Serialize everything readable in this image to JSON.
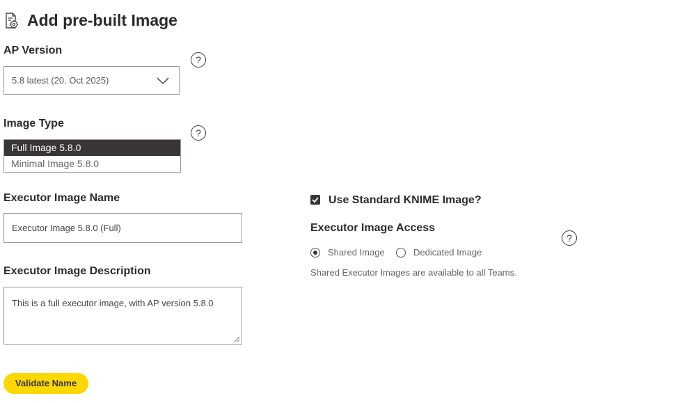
{
  "page": {
    "title": "Add pre-built Image",
    "title_icon": "document-gear-icon"
  },
  "ap_version": {
    "label": "AP Version",
    "selected": "5.8 latest (20. Oct 2025)",
    "help": "?"
  },
  "image_type": {
    "label": "Image Type",
    "help": "?",
    "options": [
      {
        "label": "Full Image 5.8.0",
        "selected": true
      },
      {
        "label": "Minimal Image 5.8.0",
        "selected": false
      }
    ]
  },
  "executor_name": {
    "label": "Executor Image Name",
    "value": "Executor Image 5.8.0 (Full)"
  },
  "executor_description": {
    "label": "Executor Image Description",
    "value": "This is a full executor image, with AP version 5.8.0"
  },
  "standard_image": {
    "label": "Use Standard KNIME Image?",
    "checked": true
  },
  "access": {
    "label": "Executor Image Access",
    "help": "?",
    "options": [
      {
        "label": "Shared Image",
        "selected": true
      },
      {
        "label": "Dedicated Image",
        "selected": false
      }
    ],
    "hint": "Shared Executor Images are available to all Teams."
  },
  "validate_button": {
    "label": "Validate Name",
    "color": "#fdd800"
  }
}
